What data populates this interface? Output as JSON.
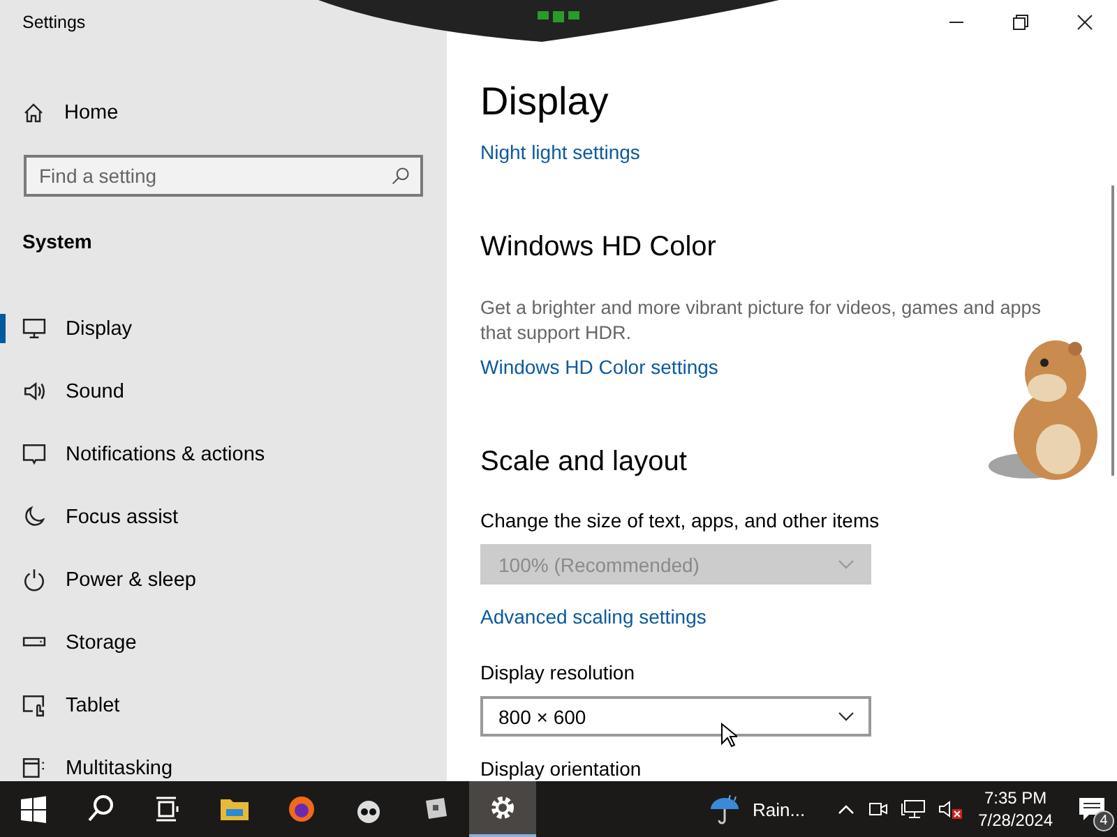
{
  "window": {
    "title": "Settings"
  },
  "sidebar": {
    "home": "Home",
    "search": {
      "placeholder": "Find a setting"
    },
    "section": "System",
    "items": [
      {
        "label": "Display",
        "selected": true
      },
      {
        "label": "Sound",
        "selected": false
      },
      {
        "label": "Notifications & actions",
        "selected": false
      },
      {
        "label": "Focus assist",
        "selected": false
      },
      {
        "label": "Power & sleep",
        "selected": false
      },
      {
        "label": "Storage",
        "selected": false
      },
      {
        "label": "Tablet",
        "selected": false
      },
      {
        "label": "Multitasking",
        "selected": false
      }
    ]
  },
  "content": {
    "title": "Display",
    "blocks": [
      {
        "kind": "link",
        "text": "Night light settings"
      },
      {
        "kind": "heading",
        "text": "Windows HD Color"
      },
      {
        "kind": "description",
        "text": "Get a brighter and more vibrant picture for videos, games and apps that support HDR."
      },
      {
        "kind": "link",
        "text": "Windows HD Color settings"
      },
      {
        "kind": "heading",
        "text": "Scale and layout"
      },
      {
        "kind": "label",
        "text": "Change the size of text, apps, and other items"
      },
      {
        "kind": "dropdown",
        "value": "100% (Recommended)",
        "disabled": true
      },
      {
        "kind": "link",
        "text": "Advanced scaling settings"
      },
      {
        "kind": "label",
        "text": "Display resolution"
      },
      {
        "kind": "dropdown",
        "value": "800 × 600",
        "disabled": false
      },
      {
        "kind": "label",
        "text": "Display orientation"
      }
    ]
  },
  "taskbar": {
    "apps": [
      {
        "kind": "start",
        "selected": false
      },
      {
        "kind": "search",
        "selected": false
      },
      {
        "kind": "taskview",
        "selected": false
      },
      {
        "kind": "files",
        "selected": false
      },
      {
        "kind": "browser",
        "selected": false
      },
      {
        "kind": "ghost",
        "selected": false
      },
      {
        "kind": "cube",
        "selected": false
      },
      {
        "kind": "settings",
        "selected": true
      }
    ],
    "weather": "Rain...",
    "time": "7:35 PM",
    "date": "7/28/2024",
    "notifications": "4"
  }
}
